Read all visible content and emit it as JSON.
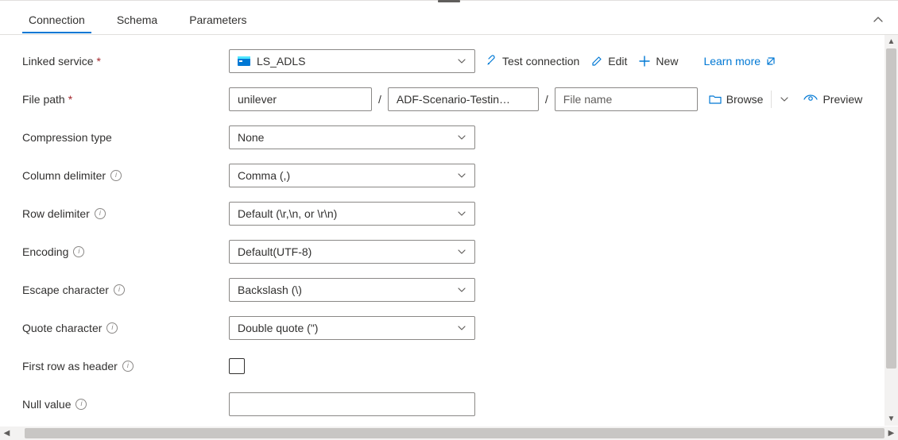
{
  "tabs": {
    "connection": "Connection",
    "schema": "Schema",
    "parameters": "Parameters"
  },
  "labels": {
    "linkedService": "Linked service",
    "filePath": "File path",
    "compressionType": "Compression type",
    "columnDelimiter": "Column delimiter",
    "rowDelimiter": "Row delimiter",
    "encoding": "Encoding",
    "escapeCharacter": "Escape character",
    "quoteCharacter": "Quote character",
    "firstRowAsHeader": "First row as header",
    "nullValue": "Null value"
  },
  "values": {
    "linkedService": "LS_ADLS",
    "filePathContainer": "unilever",
    "filePathDirectory": "ADF-Scenario-Testin…",
    "filePathFileNamePlaceholder": "File name",
    "compressionType": "None",
    "columnDelimiter": "Comma (,)",
    "rowDelimiter": "Default (\\r,\\n, or \\r\\n)",
    "encoding": "Default(UTF-8)",
    "escapeCharacter": "Backslash (\\)",
    "quoteCharacter": "Double quote (\")",
    "nullValue": ""
  },
  "actions": {
    "testConnection": "Test connection",
    "edit": "Edit",
    "new": "New",
    "learnMore": "Learn more",
    "browse": "Browse",
    "preview": "Preview"
  },
  "colors": {
    "accent": "#0078d4",
    "required": "#a4262c"
  }
}
